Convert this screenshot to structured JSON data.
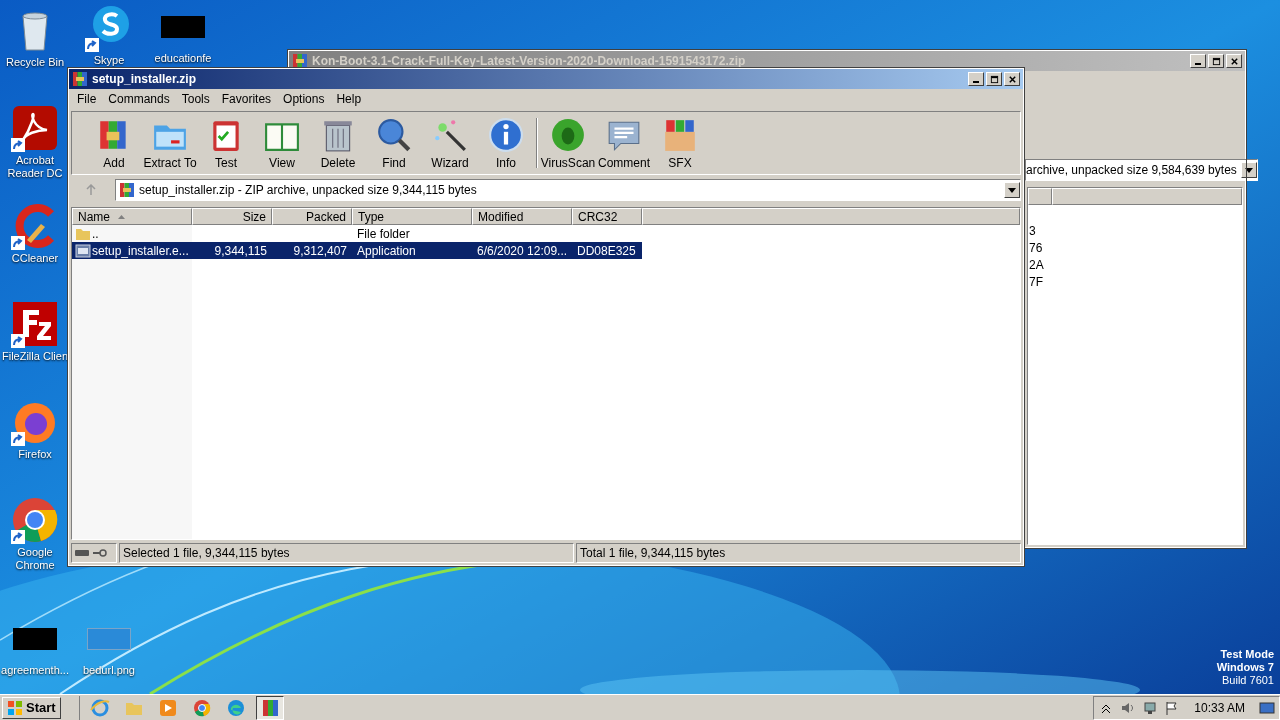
{
  "desktop": {
    "icons": [
      {
        "label": "Recycle Bin",
        "kind": "recycle",
        "shortcut": false
      },
      {
        "label": "Skype",
        "kind": "skype",
        "shortcut": true
      },
      {
        "label": "educationfe",
        "kind": "redacted",
        "shortcut": false
      },
      {
        "label": "Acrobat Reader DC",
        "kind": "acrobat",
        "shortcut": true
      },
      {
        "label": "CCleaner",
        "kind": "ccleaner",
        "shortcut": true
      },
      {
        "label": "FileZilla Clien",
        "kind": "filezilla",
        "shortcut": true
      },
      {
        "label": "Firefox",
        "kind": "firefox",
        "shortcut": true
      },
      {
        "label": "Google Chrome",
        "kind": "chrome",
        "shortcut": true
      },
      {
        "label": "agreementh...",
        "kind": "redacted",
        "shortcut": false
      },
      {
        "label": "bedurl.png",
        "kind": "blank",
        "shortcut": false
      }
    ],
    "system_notice": [
      "Test Mode",
      "Windows 7",
      "Build 7601"
    ]
  },
  "back_window": {
    "title": "Kon-Boot-3.1-Crack-Full-Key-Latest-Version-2020-Download-1591543172.zip",
    "active": false,
    "address": "archive, unpacked size 9,584,639 bytes",
    "crc_fragments": [
      "3",
      "76",
      "2A",
      "7F"
    ]
  },
  "window": {
    "title": "setup_installer.zip",
    "active": true,
    "menu": [
      "File",
      "Commands",
      "Tools",
      "Favorites",
      "Options",
      "Help"
    ],
    "toolbar": [
      {
        "label": "Add"
      },
      {
        "label": "Extract To"
      },
      {
        "label": "Test"
      },
      {
        "label": "View"
      },
      {
        "label": "Delete"
      },
      {
        "label": "Find"
      },
      {
        "label": "Wizard"
      },
      {
        "label": "Info"
      },
      {
        "label": "VirusScan"
      },
      {
        "label": "Comment"
      },
      {
        "label": "SFX"
      }
    ],
    "address": "setup_installer.zip - ZIP archive, unpacked size 9,344,115 bytes",
    "columns": [
      {
        "label": "Name",
        "sorted": true,
        "kind": "text"
      },
      {
        "label": "Size",
        "sorted": false,
        "kind": "number"
      },
      {
        "label": "Packed",
        "sorted": false,
        "kind": "number"
      },
      {
        "label": "Type",
        "sorted": false,
        "kind": "text"
      },
      {
        "label": "Modified",
        "sorted": false,
        "kind": "text"
      },
      {
        "label": "CRC32",
        "sorted": false,
        "kind": "text"
      }
    ],
    "rows": [
      {
        "kind": "folder",
        "cells": [
          "..",
          "",
          "",
          "File folder",
          "",
          ""
        ],
        "selected": false
      },
      {
        "kind": "file",
        "cells": [
          "setup_installer.e...",
          "9,344,115",
          "9,312,407",
          "Application",
          "6/6/2020 12:09...",
          "DD08E325"
        ],
        "selected": true
      }
    ],
    "status": [
      "Selected 1 file, 9,344,115 bytes",
      "Total 1 file, 9,344,115 bytes"
    ]
  },
  "taskbar": {
    "start": "Start",
    "apps": [
      {
        "kind": "ie",
        "active": false
      },
      {
        "kind": "explorer",
        "active": false
      },
      {
        "kind": "media",
        "active": false
      },
      {
        "kind": "chrome",
        "active": false
      },
      {
        "kind": "edge",
        "active": false
      },
      {
        "kind": "winrar",
        "active": true
      }
    ],
    "clock": "10:33 AM"
  }
}
